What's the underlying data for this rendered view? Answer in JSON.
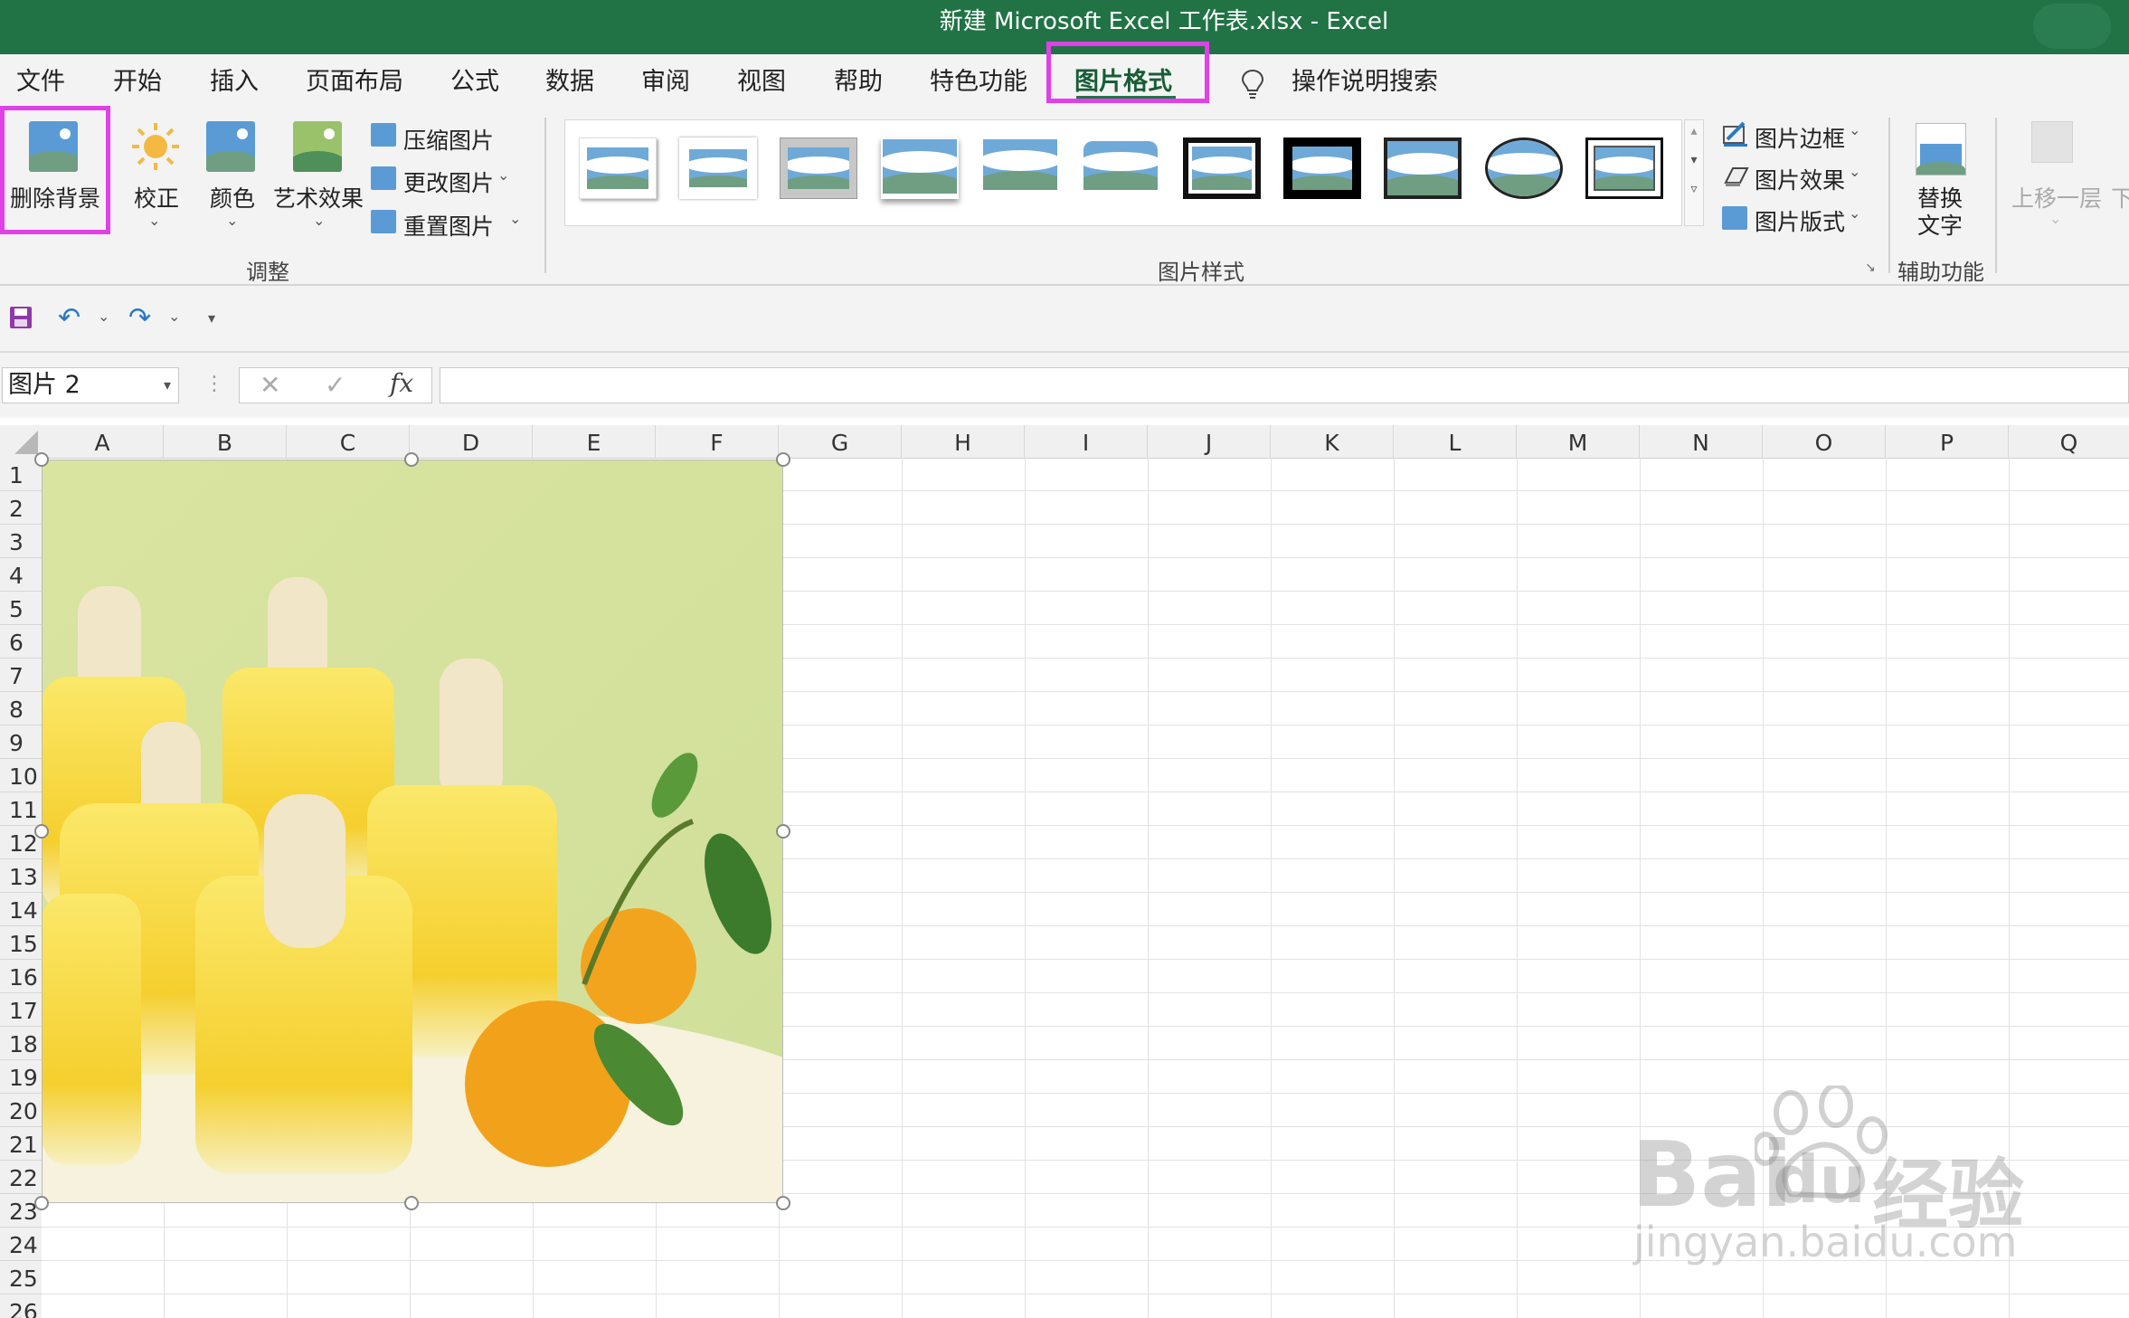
{
  "window": {
    "title": "新建 Microsoft Excel 工作表.xlsx  -  Excel"
  },
  "menu": {
    "tabs": [
      "文件",
      "开始",
      "插入",
      "页面布局",
      "公式",
      "数据",
      "审阅",
      "视图",
      "帮助",
      "特色功能",
      "图片格式"
    ],
    "active_tab": "图片格式",
    "search_label": "操作说明搜索"
  },
  "ribbon": {
    "adjust": {
      "remove_background": "删除背景",
      "corrections": "校正",
      "color": "颜色",
      "artistic_effects": "艺术效果",
      "compress_pictures": "压缩图片",
      "change_picture": "更改图片",
      "reset_picture": "重置图片",
      "group_label": "调整"
    },
    "styles": {
      "group_label": "图片样式"
    },
    "style_side": {
      "picture_border": "图片边框",
      "picture_effects": "图片效果",
      "picture_layout": "图片版式"
    },
    "accessibility": {
      "alt_text_line1": "替换",
      "alt_text_line2": "文字",
      "group_label": "辅助功能"
    },
    "arrange": {
      "bring_forward": "上移一层",
      "send_backward": "下"
    }
  },
  "formula_bar": {
    "name_box": "图片 2",
    "fx_label": "fx",
    "formula": ""
  },
  "grid": {
    "columns": [
      "A",
      "B",
      "C",
      "D",
      "E",
      "F",
      "G",
      "H",
      "I",
      "J",
      "K",
      "L",
      "M",
      "N",
      "O",
      "P",
      "Q"
    ],
    "rows": [
      "1",
      "2",
      "3",
      "4",
      "5",
      "6",
      "7",
      "8",
      "9",
      "10",
      "11",
      "12",
      "13",
      "14",
      "15",
      "16",
      "17",
      "18",
      "19",
      "20",
      "21",
      "22",
      "23",
      "24",
      "25",
      "26"
    ]
  },
  "watermark": {
    "brand": "Bai",
    "brand2": "du",
    "site_cn": "经验",
    "url": "jingyan.baidu.com"
  },
  "colors": {
    "title_bar": "#217346",
    "highlight": "#e040e8",
    "active_tab_text": "#185c37"
  }
}
